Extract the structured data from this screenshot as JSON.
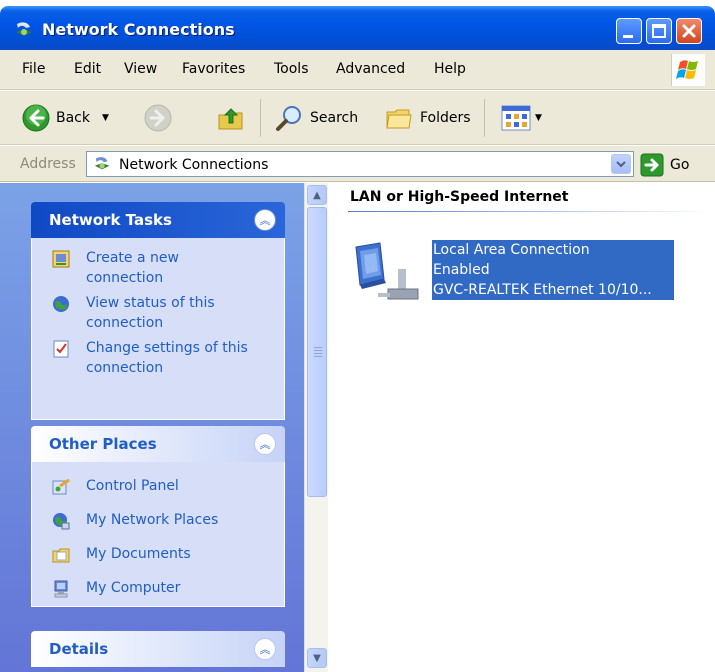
{
  "window": {
    "title": "Network Connections",
    "icon": "network-connections-icon"
  },
  "menu": {
    "items": [
      "File",
      "Edit",
      "View",
      "Favorites",
      "Tools",
      "Advanced",
      "Help"
    ]
  },
  "toolbar": {
    "back_label": "Back",
    "search_label": "Search",
    "folders_label": "Folders"
  },
  "address": {
    "label": "Address",
    "value": "Network Connections",
    "go_label": "Go"
  },
  "network_tasks": {
    "title": "Network Tasks",
    "items": [
      {
        "line1": "Create a new",
        "line2": "connection",
        "icon": "new-connection-icon"
      },
      {
        "line1": "View status of this",
        "line2": "connection",
        "icon": "status-globe-icon"
      },
      {
        "line1": "Change settings of this",
        "line2": "connection",
        "icon": "settings-checklist-icon"
      }
    ]
  },
  "other_places": {
    "title": "Other Places",
    "items": [
      {
        "label": "Control Panel",
        "icon": "control-panel-icon"
      },
      {
        "label": "My Network Places",
        "icon": "network-places-icon"
      },
      {
        "label": "My Documents",
        "icon": "documents-folder-icon"
      },
      {
        "label": "My Computer",
        "icon": "computer-icon"
      }
    ]
  },
  "details": {
    "title": "Details"
  },
  "content": {
    "group_title": "LAN or High-Speed Internet",
    "connection": {
      "name": "Local Area Connection",
      "status": "Enabled",
      "device": "GVC-REALTEK Ethernet 10/10..."
    }
  },
  "colors": {
    "titlebar": "#0055e5",
    "task_pane": "#7ba2e7",
    "link": "#215dc6",
    "selection": "#316ac5"
  }
}
